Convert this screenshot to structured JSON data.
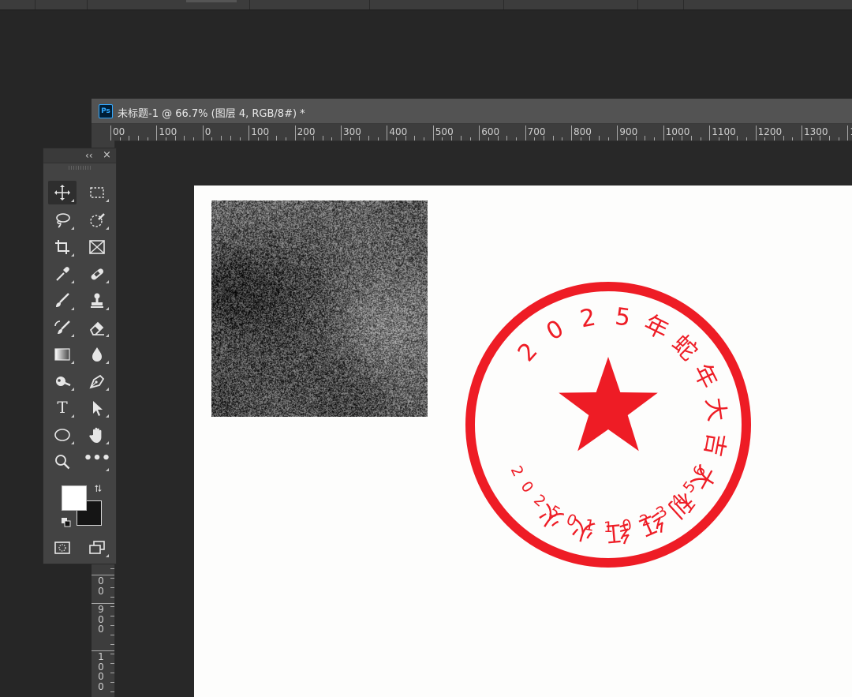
{
  "document": {
    "ps_badge": "Ps",
    "title": "未标题-1 @ 66.7% (图层 4, RGB/8#) *"
  },
  "ruler_top": {
    "labels": [
      "00",
      "100",
      "0",
      "100",
      "200",
      "300",
      "400",
      "500",
      "600",
      "700",
      "800",
      "900",
      "1000",
      "1100",
      "1200",
      "1300",
      "14"
    ]
  },
  "ruler_left": {
    "labels": [
      [
        "0",
        "0"
      ],
      [
        "9",
        "0",
        "0"
      ],
      [
        "1",
        "0",
        "0",
        "0"
      ]
    ]
  },
  "tools_panel": {
    "collapse_label": "‹‹",
    "close_label": "×",
    "tools": [
      {
        "name": "move-tool",
        "icon": "move-icon",
        "active": true
      },
      {
        "name": "rectangular-marquee-tool",
        "icon": "marquee-icon"
      },
      {
        "name": "lasso-tool",
        "icon": "lasso-icon"
      },
      {
        "name": "quick-selection-tool",
        "icon": "quick-selection-icon"
      },
      {
        "name": "crop-tool",
        "icon": "crop-icon"
      },
      {
        "name": "frame-tool",
        "icon": "frame-icon"
      },
      {
        "name": "eyedropper-tool",
        "icon": "eyedropper-icon"
      },
      {
        "name": "healing-brush-tool",
        "icon": "bandage-icon"
      },
      {
        "name": "brush-tool",
        "icon": "brush-icon"
      },
      {
        "name": "clone-stamp-tool",
        "icon": "stamp-icon"
      },
      {
        "name": "history-brush-tool",
        "icon": "history-brush-icon"
      },
      {
        "name": "eraser-tool",
        "icon": "eraser-icon"
      },
      {
        "name": "gradient-tool",
        "icon": "gradient-icon"
      },
      {
        "name": "blur-tool",
        "icon": "drop-icon"
      },
      {
        "name": "dodge-tool",
        "icon": "dodge-icon"
      },
      {
        "name": "pen-tool",
        "icon": "pen-icon"
      },
      {
        "name": "type-tool",
        "icon": "type-icon",
        "glyph": "T"
      },
      {
        "name": "path-selection-tool",
        "icon": "arrow-icon"
      },
      {
        "name": "ellipse-tool",
        "icon": "ellipse-icon"
      },
      {
        "name": "hand-tool",
        "icon": "hand-icon"
      },
      {
        "name": "zoom-tool",
        "icon": "zoom-icon"
      },
      {
        "name": "more-tools",
        "icon": "more-icon",
        "glyph": "•••"
      }
    ],
    "foreground_color": "#ffffff",
    "background_color": "#151515"
  },
  "stamp": {
    "color": "#ee1c25",
    "arc_text": "2025年蛇年大吉大利红红火火",
    "serial": "2025011023456"
  }
}
